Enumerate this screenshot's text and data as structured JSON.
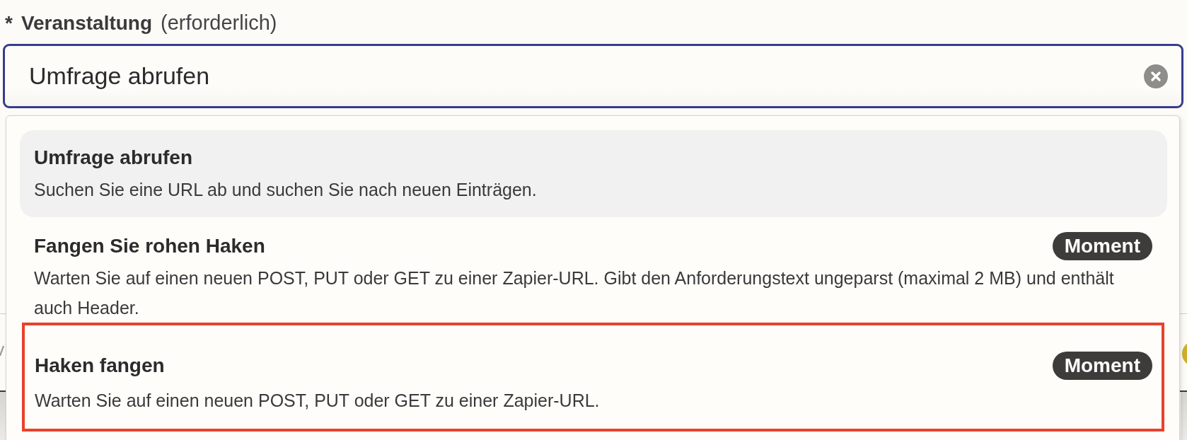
{
  "field": {
    "required_mark": "*",
    "label": "Veranstaltung",
    "hint": "(erforderlich)",
    "value": "Umfrage abrufen",
    "clearable": true
  },
  "options": [
    {
      "title": "Umfrage abrufen",
      "description": "Suchen Sie eine URL ab und suchen Sie nach neuen Einträgen.",
      "selected": true,
      "highlighted": false
    },
    {
      "title": "Fangen Sie rohen Haken",
      "badge": "Moment",
      "description": "Warten Sie auf einen neuen POST, PUT oder GET zu einer Zapier-URL. Gibt den Anforderungstext ungeparst (maximal 2 MB) und enthält auch Header.",
      "selected": false,
      "highlighted": false
    },
    {
      "title": "Haken fangen",
      "badge": "Moment",
      "description": "Warten Sie auf einen neuen POST, PUT oder GET zu einer Zapier-URL.",
      "selected": false,
      "highlighted": true
    }
  ]
}
